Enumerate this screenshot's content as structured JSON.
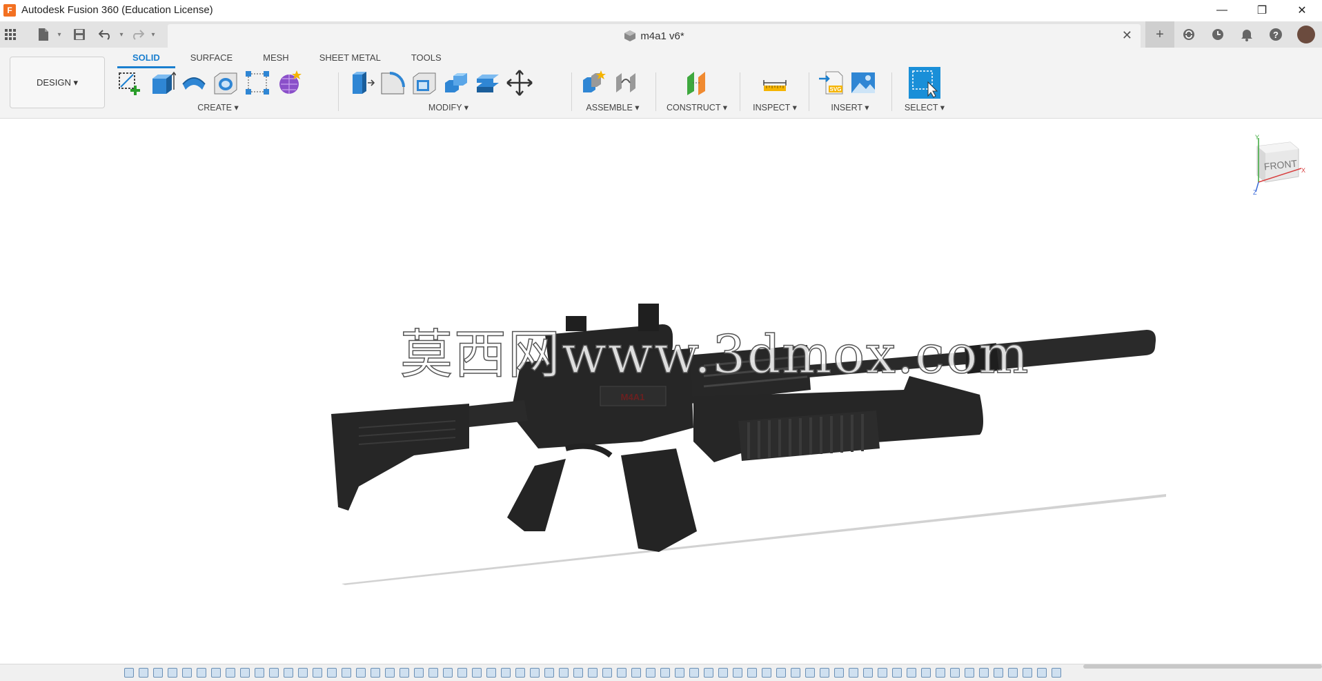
{
  "titlebar": {
    "logo_letter": "F",
    "title": "Autodesk Fusion 360 (Education License)",
    "minimize": "—",
    "restore": "❐",
    "close": "✕"
  },
  "tabbar": {
    "document_title": "m4a1 v6*",
    "close_symbol": "✕",
    "add_symbol": "+"
  },
  "toolbar": {
    "workspace": "DESIGN ▾",
    "tabs": [
      "SOLID",
      "SURFACE",
      "MESH",
      "SHEET METAL",
      "TOOLS"
    ],
    "groups": {
      "create": "CREATE ▾",
      "modify": "MODIFY ▾",
      "assemble": "ASSEMBLE ▾",
      "construct": "CONSTRUCT ▾",
      "inspect": "INSPECT ▾",
      "insert": "INSERT ▾",
      "select": "SELECT ▾"
    }
  },
  "viewport": {
    "viewcube_label": "FRONT",
    "axis_y": "Y",
    "axis_x": "X",
    "axis_z": "Z",
    "watermark": "莫西网www.3dmox.com",
    "model_marking": "M4A1"
  },
  "icons": {
    "apps": "grid-icon",
    "file": "file-icon",
    "save": "save-icon",
    "undo": "undo-icon",
    "redo": "redo-icon",
    "job_status": "sync-icon",
    "recent": "clock-icon",
    "notifications": "bell-icon",
    "help": "help-icon"
  },
  "colors": {
    "accent": "#1a7fcf",
    "model": "#2a2a2a",
    "brand": "#f37021"
  }
}
